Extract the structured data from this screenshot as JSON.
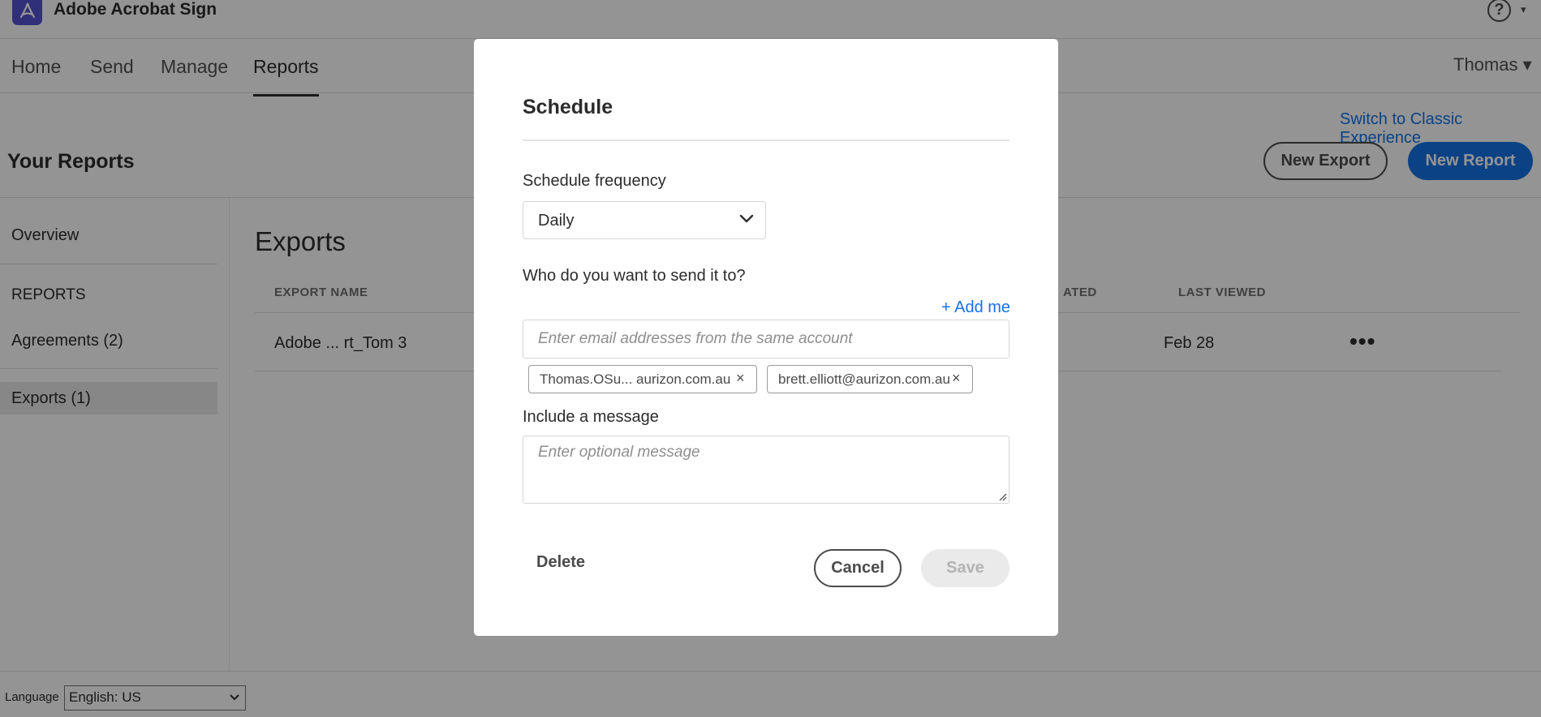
{
  "app": {
    "title": "Adobe Acrobat Sign",
    "help_symbol": "?",
    "caret": "▾"
  },
  "nav": {
    "tabs": [
      {
        "label": "Home"
      },
      {
        "label": "Send"
      },
      {
        "label": "Manage"
      },
      {
        "label": "Reports"
      }
    ],
    "active_tab": "Reports",
    "user": "Thomas ▾"
  },
  "page": {
    "switch_link": "Switch to Classic Experience",
    "title": "Your Reports",
    "new_export_label": "New Export",
    "new_report_label": "New Report"
  },
  "sidebar": {
    "overview": "Overview",
    "heading": "REPORTS",
    "agreements": "Agreements (2)",
    "exports": "Exports (1)"
  },
  "main": {
    "section_title": "Exports",
    "columns": [
      "EXPORT NAME",
      "ATED",
      "LAST VIEWED"
    ],
    "row": {
      "name": "Adobe ...  rt_Tom 3",
      "last_viewed": "Feb 28",
      "more": "•••"
    }
  },
  "footer": {
    "language_label": "Language",
    "language_value": "English: US"
  },
  "modal": {
    "title": "Schedule",
    "frequency_label": "Schedule frequency",
    "frequency_value": "Daily",
    "recipients_label": "Who do you want to send it to?",
    "add_me": "+ Add me",
    "email_placeholder": "Enter email addresses from the same account",
    "recipients": [
      {
        "email": "Thomas.OSu... aurizon.com.au"
      },
      {
        "email": "brett.elliott@aurizon.com.au"
      }
    ],
    "remove_symbol": "×",
    "message_label": "Include a message",
    "message_placeholder": "Enter optional message",
    "delete_label": "Delete",
    "cancel_label": "Cancel",
    "save_label": "Save"
  },
  "colors": {
    "accent": "#1473e6",
    "brand": "#5151d3",
    "overlay": "rgba(0,0,0,0.42)"
  }
}
